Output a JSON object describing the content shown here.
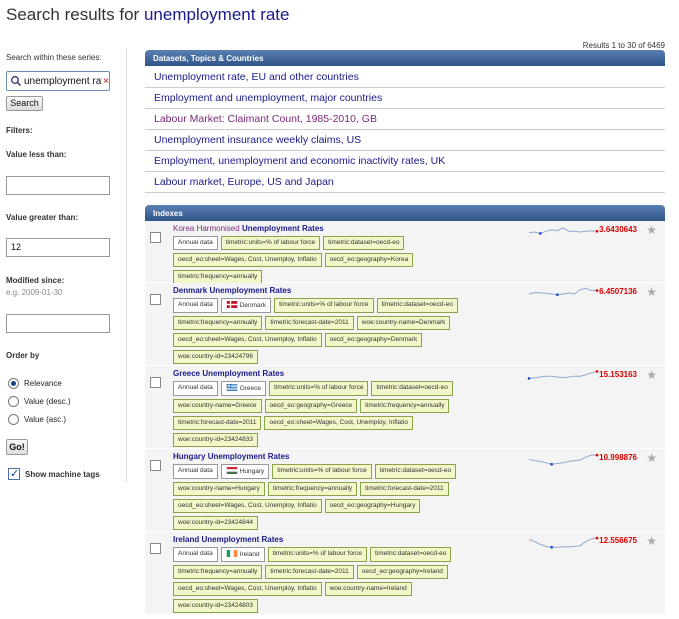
{
  "page": {
    "title_prefix": "Search results for",
    "query": "unemployment rate",
    "results_count": "Results 1 to 30 of 6469"
  },
  "sidebar": {
    "search_within_label": "Search within these series:",
    "search_value": "unemployment rates",
    "search_clear": "×",
    "search_button": "Search",
    "filters_label": "Filters:",
    "value_less_label": "Value less than:",
    "value_less_value": "",
    "value_greater_label": "Value greater than:",
    "value_greater_value": "12",
    "modified_since_label": "Modified since:",
    "modified_hint": "e.g. 2009-01-30",
    "modified_value": "",
    "order_by_label": "Order by",
    "order_options": [
      "Relevance",
      "Value (desc.)",
      "Value (asc.)"
    ],
    "order_selected": 0,
    "go_button": "Go!",
    "show_machine_tags": "Show machine tags"
  },
  "datasets": {
    "header": "Datasets, Topics & Countries",
    "items": [
      {
        "label": "Unemployment rate, EU and other countries",
        "visited": false
      },
      {
        "label": "Employment and unemployment, major countries",
        "visited": false
      },
      {
        "label": "Labour Market: Claimant Count, 1985-2010, GB",
        "visited": true
      },
      {
        "label": "Unemployment insurance weekly claims, US",
        "visited": false
      },
      {
        "label": "Employment, unemployment and economic inactivity rates, UK",
        "visited": false
      },
      {
        "label": "Labour market, Europe, US and Japan",
        "visited": false
      }
    ]
  },
  "indexes": {
    "header": "Indexes",
    "items": [
      {
        "country": "Korea Harmonised",
        "name": "Unemployment Rates",
        "value": "3.6430643",
        "spark": [
          0.55,
          0.5,
          0.6,
          0.45,
          0.35,
          0.4,
          0.2,
          0.45,
          0.45,
          0.5,
          0.45,
          0.42,
          0.45
        ],
        "tags": [
          [
            "Annual data",
            "timetric:units=% of labour force",
            "timetric:dataset=oecd-eo"
          ],
          [
            "oecd_eo:sheet=Wages, Cost, Unemploy, Inflatio",
            "oecd_eo:geography=Korea"
          ],
          [
            "timetric:frequency=annually"
          ]
        ]
      },
      {
        "country": "Denmark",
        "name": "Unemployment Rates",
        "value": "6.4507136",
        "flag": "Denmark",
        "spark": [
          0.5,
          0.4,
          0.42,
          0.45,
          0.5,
          0.55,
          0.5,
          0.42,
          0.5,
          0.2,
          0.1,
          0.25,
          0.25
        ],
        "tags": [
          [
            "Annual data",
            "@Denmark",
            "timetric:units=% of labour force",
            "timetric:dataset=oecd-eo"
          ],
          [
            "timetric:frequency=annually",
            "timetric:forecast-date=2011",
            "woe:country-name=Denmark"
          ],
          [
            "oecd_eo:sheet=Wages, Cost, Unemploy, Inflatio",
            "oecd_eo:geography=Denmark"
          ],
          [
            "woe:country-id=23424796"
          ]
        ]
      },
      {
        "country": "Greece",
        "name": "Unemployment Rates",
        "value": "15.153163",
        "flag": "Greece",
        "spark": [
          0.6,
          0.55,
          0.5,
          0.45,
          0.45,
          0.5,
          0.55,
          0.5,
          0.45,
          0.45,
          0.35,
          0.2,
          0.1
        ],
        "tags": [
          [
            "Annual data",
            "@Greece",
            "timetric:units=% of labour force",
            "timetric:dataset=oecd-eo"
          ],
          [
            "woe:country-name=Greece",
            "oecd_eo:geography=Greece",
            "timetric:frequency=annually"
          ],
          [
            "timetric:forecast-date=2011",
            "oecd_eo:sheet=Wages, Cost, Unemploy, Inflatio"
          ],
          [
            "woe:country-id=23424833"
          ]
        ]
      },
      {
        "country": "Hungary",
        "name": "Unemployment Rates",
        "value": "10.998876",
        "flag": "Hungary",
        "spark": [
          0.45,
          0.55,
          0.6,
          0.7,
          0.8,
          0.75,
          0.7,
          0.6,
          0.55,
          0.5,
          0.3,
          0.15,
          0.15
        ],
        "tags": [
          [
            "Annual data",
            "@Hungary",
            "timetric:units=% of labour force",
            "timetric:dataset=oecd-eo"
          ],
          [
            "woe:country-name=Hungary",
            "timetric:frequency=annually",
            "timetric:forecast-date=2011"
          ],
          [
            "oecd_eo:sheet=Wages, Cost, Unemploy, Inflatio",
            "oecd_eo:geography=Hungary"
          ],
          [
            "woe:country-id=23424844"
          ]
        ]
      },
      {
        "country": "Ireland",
        "name": "Unemployment Rates",
        "value": "12.556675",
        "flag": "Ireland",
        "spark": [
          0.25,
          0.4,
          0.6,
          0.75,
          0.8,
          0.8,
          0.78,
          0.78,
          0.75,
          0.7,
          0.4,
          0.2,
          0.15
        ],
        "tags": [
          [
            "Annual data",
            "@Ireland",
            "timetric:units=% of labour force",
            "timetric:dataset=oecd-eo"
          ],
          [
            "timetric:frequency=annually",
            "timetric:forecast-date=2011",
            "oecd_eo:geography=Ireland"
          ],
          [
            "oecd_eo:sheet=Wages, Cost, Unemploy, Inflatio",
            "woe:country-name=Ireland"
          ],
          [
            "woe:country-id=23424803"
          ]
        ]
      }
    ]
  },
  "colors": {
    "header_blue": "#2e5488",
    "link_blue": "#1a1a8c",
    "visited_purple": "#7a2a7a",
    "value_red": "#dd0000",
    "tag_bg": "#f2f6c8",
    "tag_border": "#8aa24a",
    "spark_line": "#8fa9cf",
    "spark_dot_blue": "#1a3fd0",
    "spark_dot_red": "#dd0000"
  }
}
